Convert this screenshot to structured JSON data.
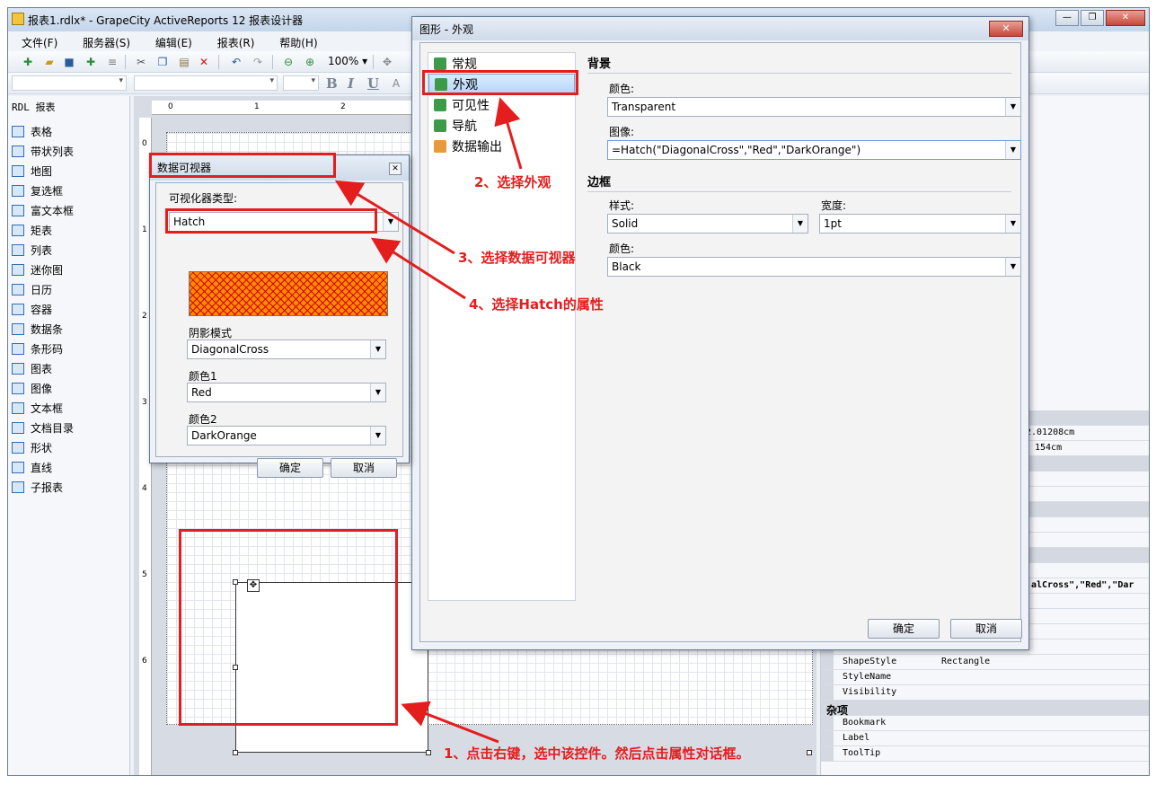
{
  "window": {
    "title": "报表1.rdlx* - GrapeCity ActiveReports 12 报表设计器",
    "controls": [
      "—",
      "❐",
      "✕"
    ]
  },
  "menu": [
    "文件(F)",
    "服务器(S)",
    "编辑(E)",
    "报表(R)",
    "帮助(H)"
  ],
  "toolbar": {
    "zoom": "100%",
    "format_buttons": [
      "B",
      "I",
      "U"
    ]
  },
  "toolbox": {
    "header": "RDL 报表",
    "items": [
      {
        "label": "表格",
        "icon": "table-icon"
      },
      {
        "label": "带状列表",
        "icon": "banded-list-icon"
      },
      {
        "label": "地图",
        "icon": "globe-icon"
      },
      {
        "label": "复选框",
        "icon": "checkbox-icon"
      },
      {
        "label": "富文本框",
        "icon": "rich-text-icon"
      },
      {
        "label": "矩表",
        "icon": "matrix-icon"
      },
      {
        "label": "列表",
        "icon": "list-icon"
      },
      {
        "label": "迷你图",
        "icon": "sparkline-icon"
      },
      {
        "label": "日历",
        "icon": "calendar-icon"
      },
      {
        "label": "容器",
        "icon": "container-icon"
      },
      {
        "label": "数据条",
        "icon": "databar-icon"
      },
      {
        "label": "条形码",
        "icon": "barcode-icon"
      },
      {
        "label": "图表",
        "icon": "chart-icon"
      },
      {
        "label": "图像",
        "icon": "image-icon"
      },
      {
        "label": "文本框",
        "icon": "textbox-icon"
      },
      {
        "label": "文档目录",
        "icon": "toc-icon"
      },
      {
        "label": "形状",
        "icon": "shape-icon"
      },
      {
        "label": "直线",
        "icon": "line-icon"
      },
      {
        "label": "子报表",
        "icon": "subreport-icon"
      }
    ]
  },
  "ruler": {
    "h": [
      "0",
      "1",
      "2"
    ],
    "v": [
      "0",
      "1",
      "2",
      "3",
      "4",
      "5",
      "6"
    ]
  },
  "properties": {
    "size_values": [
      "2.01208cm",
      "154cm"
    ],
    "hatch_value": "alCross\",\"Red\",\"Dar",
    "rows": [
      {
        "name": "ShapeStyle",
        "value": "Rectangle"
      },
      {
        "name": "StyleName",
        "value": ""
      },
      {
        "name": "Visibility",
        "value": ""
      }
    ],
    "category": "杂项",
    "misc_rows": [
      "Bookmark",
      "Label",
      "ToolTip"
    ]
  },
  "shape_dialog": {
    "title": "图形 - 外观",
    "nav": [
      {
        "label": "常规",
        "selected": false
      },
      {
        "label": "外观",
        "selected": true
      },
      {
        "label": "可见性",
        "selected": false
      },
      {
        "label": "导航",
        "selected": false
      },
      {
        "label": "数据输出",
        "selected": false
      }
    ],
    "background_header": "背景",
    "bg_color_label": "颜色:",
    "bg_color_value": "Transparent",
    "bg_image_label": "图像:",
    "bg_image_value": "=Hatch(\"DiagonalCross\",\"Red\",\"DarkOrange\")",
    "border_header": "边框",
    "style_label": "样式:",
    "style_value": "Solid",
    "width_label": "宽度:",
    "width_value": "1pt",
    "border_color_label": "颜色:",
    "border_color_value": "Black",
    "ok": "确定",
    "cancel": "取消"
  },
  "visualizer_dialog": {
    "title": "数据可视器",
    "type_label": "可视化器类型:",
    "type_value": "Hatch",
    "pattern_label": "阴影模式",
    "pattern_value": "DiagonalCross",
    "color1_label": "颜色1",
    "color1_value": "Red",
    "color2_label": "颜色2",
    "color2_value": "DarkOrange",
    "ok": "确定",
    "cancel": "取消"
  },
  "annotations": {
    "step1": "1、点击右键，选中该控件。然后点击属性对话框。",
    "step2": "2、选择外观",
    "step3": "3、选择数据可视器",
    "step4": "4、选择Hatch的属性"
  },
  "colors": {
    "annotation_red": "#e41d1d",
    "hatch_fg": "#d10000",
    "hatch_bg": "#ff8c00",
    "selection": "#b5d6f7"
  }
}
